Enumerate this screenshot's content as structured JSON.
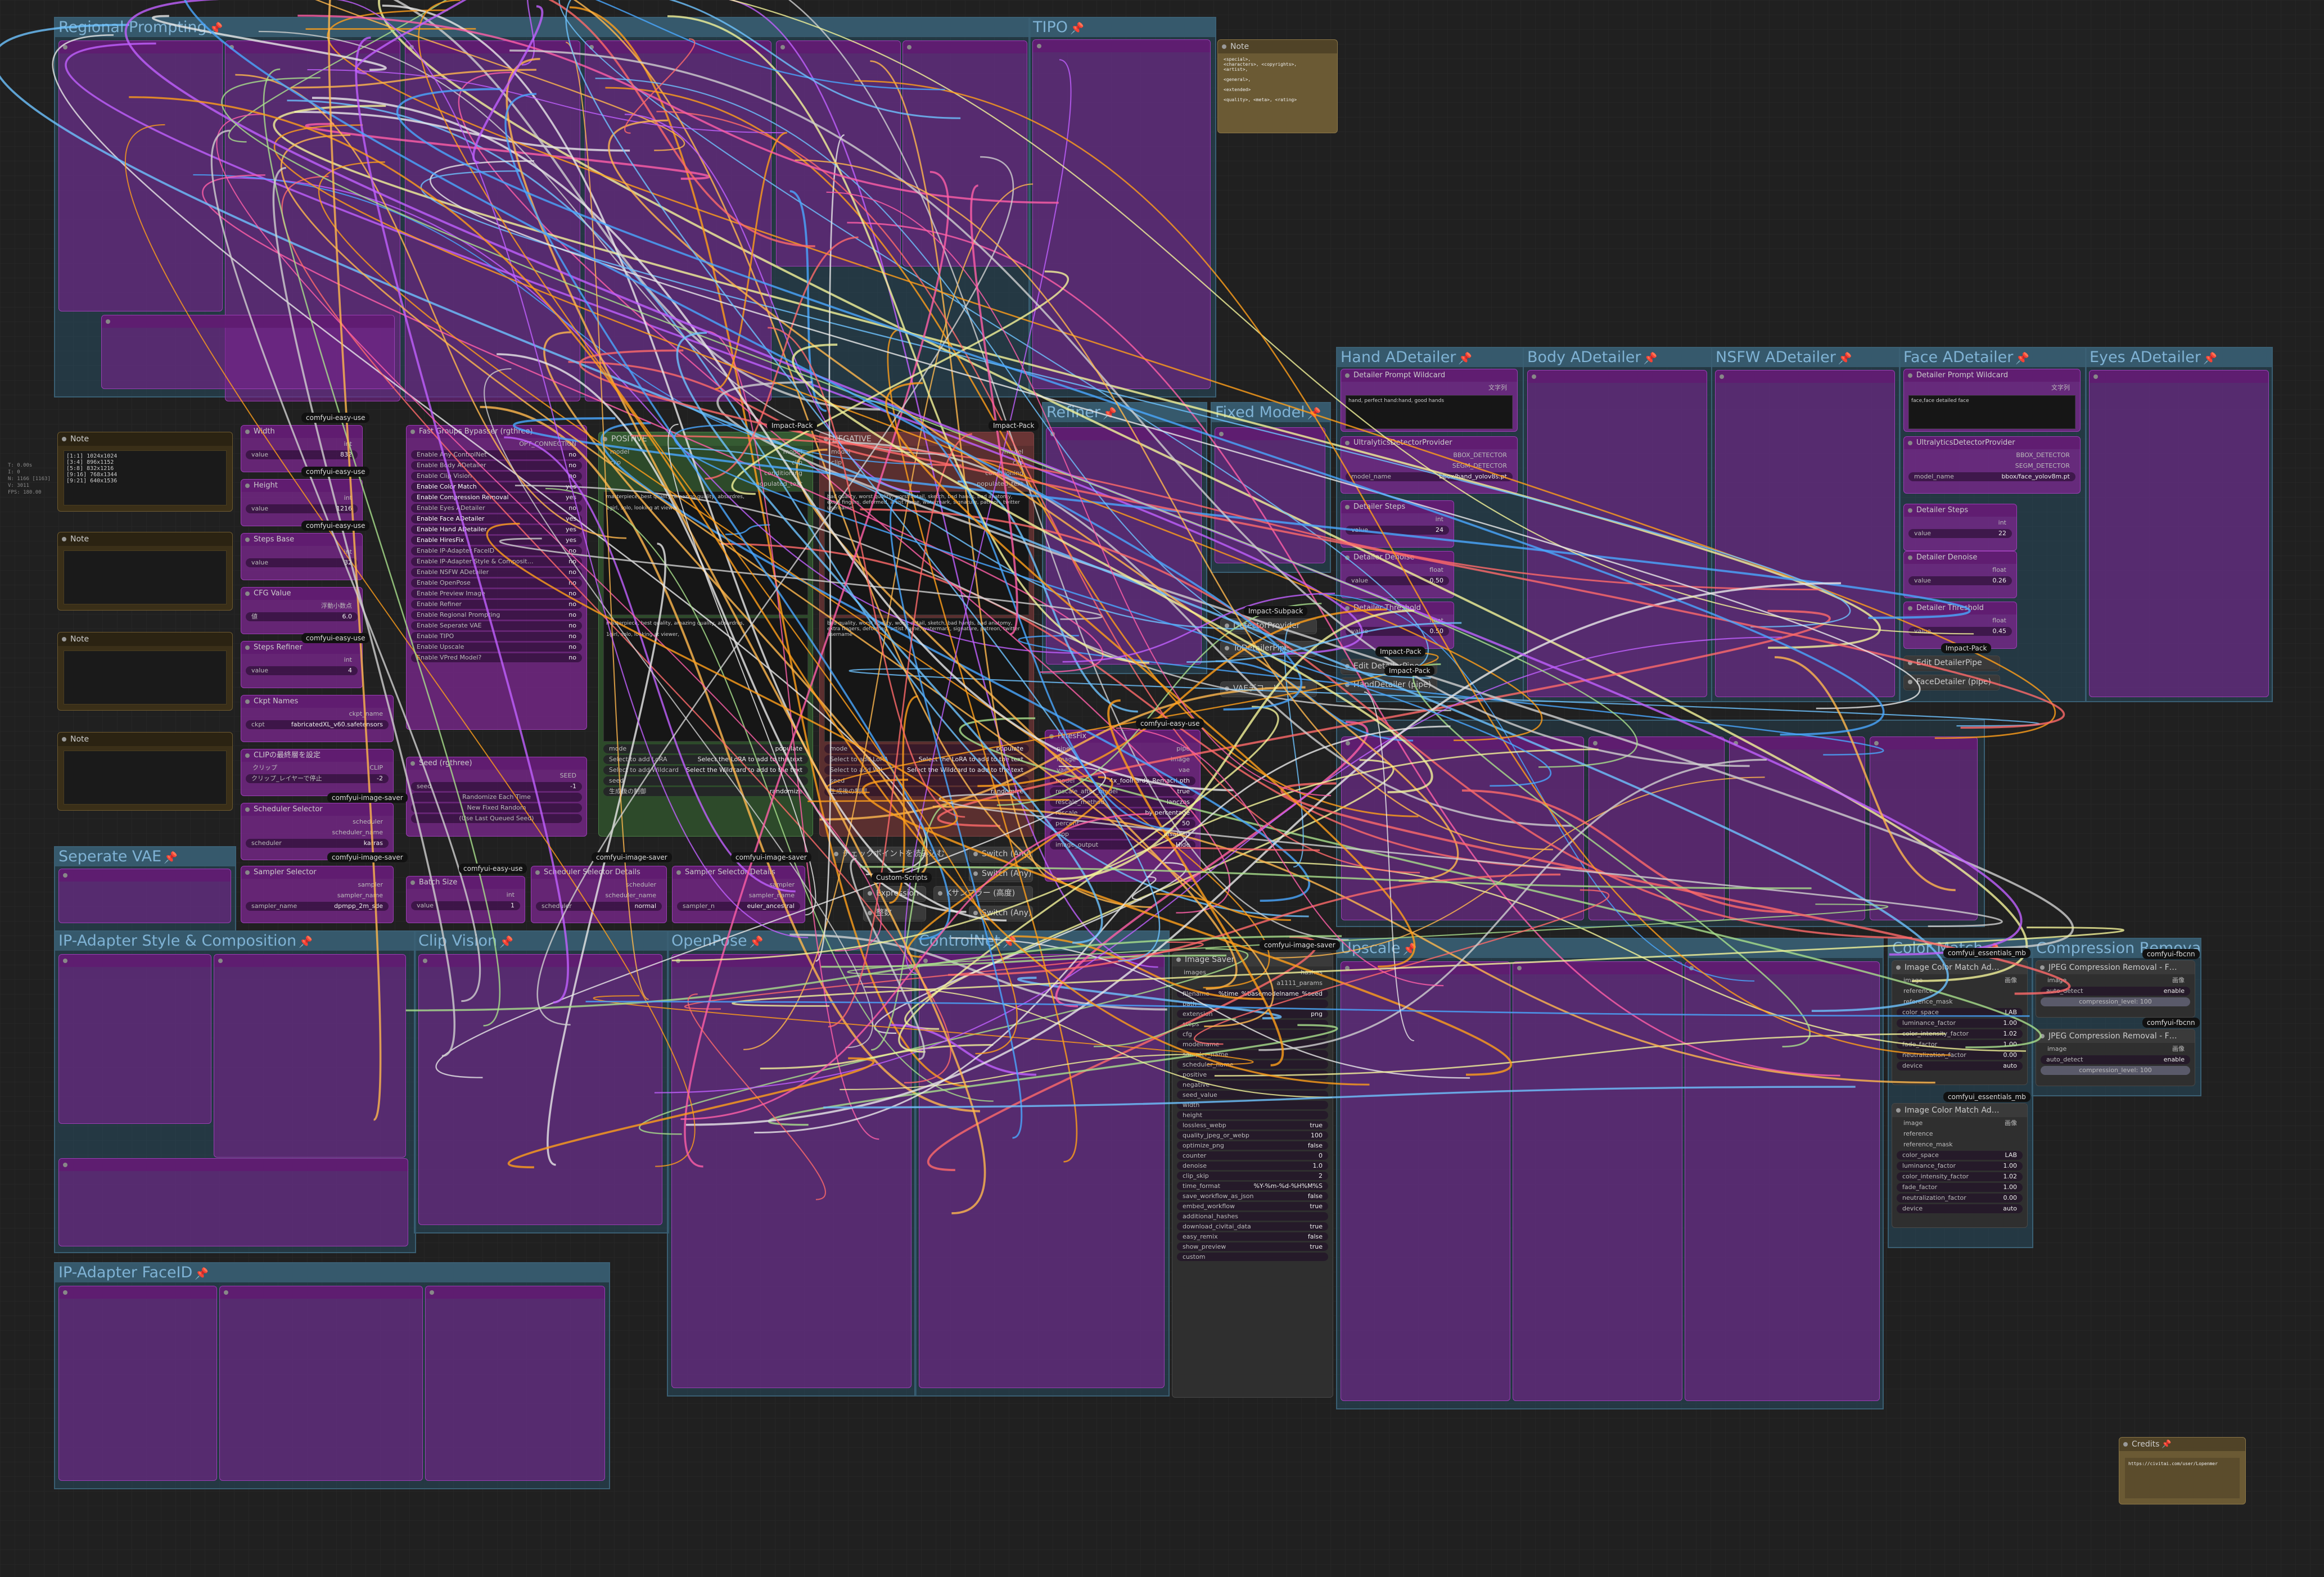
{
  "groups": [
    {
      "id": "regional",
      "title": "Regional Prompting"
    },
    {
      "id": "tipo",
      "title": "TIPO"
    },
    {
      "id": "refiner",
      "title": "Refiner"
    },
    {
      "id": "fixed",
      "title": "Fixed Model"
    },
    {
      "id": "hand",
      "title": "Hand ADetailer"
    },
    {
      "id": "body",
      "title": "Body ADetailer"
    },
    {
      "id": "nsfw",
      "title": "NSFW ADetailer"
    },
    {
      "id": "face",
      "title": "Face ADetailer"
    },
    {
      "id": "eyes",
      "title": "Eyes ADetailer"
    },
    {
      "id": "sepvae",
      "title": "Seperate VAE"
    },
    {
      "id": "ipstyle",
      "title": "IP-Adapter Style & Composition"
    },
    {
      "id": "clipvision",
      "title": "Clip Vision"
    },
    {
      "id": "openpose",
      "title": "OpenPose"
    },
    {
      "id": "controlnet",
      "title": "ControlNet"
    },
    {
      "id": "upscale",
      "title": "Upscale"
    },
    {
      "id": "colormatch",
      "title": "Color Match"
    },
    {
      "id": "compression",
      "title": "Compression Removal"
    },
    {
      "id": "faceid",
      "title": "IP-Adapter FaceID"
    }
  ],
  "badges": {
    "impact1": "Impact-Pack",
    "impact2": "Impact-Pack",
    "impact3": "Impact-Pack",
    "impact4": "Impact-Pack",
    "impact5": "Impact-Pack",
    "impactsub": "Impact-Subpack",
    "easy1": "comfyui-easy-use",
    "easy2": "comfyui-easy-use",
    "easy3": "comfyui-easy-use",
    "easy4": "comfyui-easy-use",
    "easy5": "comfyui-easy-use",
    "easy6": "comfyui-easy-use",
    "saver1": "comfyui-image-saver",
    "saver2": "comfyui-image-saver",
    "saver3": "comfyui-image-saver",
    "saver4": "comfyui-image-saver",
    "saver5": "comfyui-image-saver",
    "custom": "Custom-Scripts",
    "mb1": "comfyui_essentials_mb",
    "mb2": "comfyui_essentials_mb",
    "fbcnn1": "comfyui-fbcnn",
    "fbcnn2": "comfyui-fbcnn"
  },
  "notes": {
    "note1": {
      "title": "Note",
      "text": "[1:1] 1024x1024\n[3:4] 896x1152\n[5:8] 832x1216\n[9:16] 768x1344\n[9:21] 640x1536"
    },
    "note2": {
      "title": "Note"
    },
    "note3": {
      "title": "Note"
    },
    "note4": {
      "title": "Note"
    },
    "note_top": {
      "title": "Note",
      "text": "<special>,\n<characters>, <copyrights>,\n<artist>,\n\n<general>,\n\n<extended>\n\n<quality>, <meta>, <rating>"
    },
    "credits": {
      "title": "Credits",
      "text": "https://civitai.com/user/Lopenmer"
    }
  },
  "width_node": {
    "title": "Width",
    "type": "int",
    "value_label": "value",
    "value": "832"
  },
  "height_node": {
    "title": "Height",
    "type": "int",
    "value_label": "value",
    "value": "1216"
  },
  "steps_base": {
    "title": "Steps Base",
    "type": "int",
    "value_label": "value",
    "value": "32"
  },
  "cfg_value": {
    "title": "CFG Value",
    "type": "浮動小数点",
    "value_label": "値",
    "value": "6.0"
  },
  "steps_refiner": {
    "title": "Steps Refiner",
    "type": "int",
    "value_label": "value",
    "value": "4"
  },
  "ckpt_names": {
    "title": "Ckpt Names",
    "out": "ckpt_name",
    "label": "ckpt",
    "value": "fabricatedXL_v60.safetensors"
  },
  "clip_layer": {
    "title": "CLIPの最終層を設定",
    "in": "クリップ",
    "out": "CLIP",
    "label": "クリップ_レイヤーで停止",
    "value": "-2"
  },
  "scheduler_selector": {
    "title": "Scheduler Selector",
    "out1": "scheduler",
    "out2": "scheduler_name",
    "label": "scheduler",
    "value": "karras"
  },
  "sampler_selector": {
    "title": "Sampler Selector",
    "out1": "sampler",
    "out2": "sampler_name",
    "label": "sampler_name",
    "value": "dpmpp_2m_sde"
  },
  "batch_size": {
    "title": "Batch Size",
    "type": "int",
    "label": "value",
    "value": "1"
  },
  "scheduler_details": {
    "title": "Scheduler Selector Details",
    "out1": "scheduler",
    "out2": "scheduler_name",
    "label": "scheduler",
    "value": "normal"
  },
  "sampler_details": {
    "title": "Sampler Selector Details",
    "out1": "sampler",
    "out2": "sampler_name",
    "label": "sampler_n",
    "value": "euler_ancestral"
  },
  "seed_node": {
    "title": "Seed (rgthree)",
    "out": "SEED",
    "label": "seed",
    "value": "-1",
    "btn1": "Randomize Each Time",
    "btn2": "New Fixed Random",
    "btn3": "(Use Last Queued Seed)"
  },
  "bypasser": {
    "title": "Fast Groups Bypasser (rgthree)",
    "out": "OPT_CONNECTION",
    "items": [
      {
        "label": "Enable Any ControlNet",
        "value": "no"
      },
      {
        "label": "Enable Body ADetailer",
        "value": "no"
      },
      {
        "label": "Enable Clip Vision",
        "value": "no"
      },
      {
        "label": "Enable Color Match",
        "value": "yes"
      },
      {
        "label": "Enable Compression Removal",
        "value": "yes"
      },
      {
        "label": "Enable Eyes ADetailer",
        "value": "no"
      },
      {
        "label": "Enable Face ADetailer",
        "value": "yes"
      },
      {
        "label": "Enable Hand ADetailer",
        "value": "yes"
      },
      {
        "label": "Enable HiresFix",
        "value": "yes"
      },
      {
        "label": "Enable IP-Adapter FaceID",
        "value": "no"
      },
      {
        "label": "Enable IP-Adapter Style & Composit…",
        "value": "no"
      },
      {
        "label": "Enable NSFW ADetailer",
        "value": "no"
      },
      {
        "label": "Enable OpenPose",
        "value": "no"
      },
      {
        "label": "Enable Preview Image",
        "value": "no"
      },
      {
        "label": "Enable Refiner",
        "value": "no"
      },
      {
        "label": "Enable Regional Prompting",
        "value": "no"
      },
      {
        "label": "Enable Seperate VAE",
        "value": "no"
      },
      {
        "label": "Enable TIPO",
        "value": "no"
      },
      {
        "label": "Enable Upscale",
        "value": "no"
      },
      {
        "label": "Enable VPred Model?",
        "value": "no"
      }
    ]
  },
  "positive": {
    "title": "POSITIVE",
    "in1": "model",
    "in2": "clip",
    "out1": "model",
    "out2": "clip",
    "out3": "conditioning",
    "out4": "populated_text",
    "text1": "masterpiece, best quality, amazing quality, absurdres,\n\n1girl, solo, looking at viewer,",
    "text2": "masterpiece, best quality, amazing quality, absurdres,\n\n1girl, solo, looking at viewer,",
    "mode_label": "mode",
    "mode": "populate",
    "lora_label": "Select to add LoRA",
    "lora": "Select the LoRA to add to the text",
    "wc_label": "Select to add Wildcard",
    "wc": "Select the Wildcard to add to the text",
    "seed_label": "seed",
    "ctrl_label": "生成後の制御",
    "ctrl": "randomize"
  },
  "negative": {
    "title": "NEGATIVE",
    "in1": "model",
    "in2": "clip",
    "out1": "model",
    "out2": "clip",
    "out3": "conditioning",
    "out4": "populated_text",
    "text1": "bad quality, worst quality, worst detail, sketch, bad hands, bad anatomy, extra fingers, deformed, artist name, watermark, signature, patreon, twitter username",
    "text2": "bad quality, worst quality, worst detail, sketch, bad hands, bad anatomy, extra fingers, deformed, artist name, watermark, signature, patreon, twitter username",
    "mode_label": "mode",
    "mode": "populate",
    "lora_label": "Select to add LoRA",
    "lora": "Select the LoRA to add to the text",
    "wc_label": "Select to add Wil",
    "wc": "Select the Wildcard to add to the text",
    "seed_label": "seed",
    "ctrl_label": "生成後の制御",
    "ctrl": "randomize"
  },
  "mid_nodes": {
    "ckpt_loader": "チェックポイントを読み込む",
    "switch1": "Switch (Any)",
    "switch2": "Switch (Any)",
    "switch3": "Switch (Any)",
    "expression": "Expression",
    "ksampler": "Kサンプラー (高度)",
    "integer": "整数"
  },
  "hiresfix": {
    "title": "HiresFix",
    "in1": "pipe",
    "in2": "image",
    "in3": "vae",
    "out1": "pipe",
    "out2": "image",
    "out3": "vae",
    "rows": [
      {
        "label": "model",
        "value": "4x_foolhardy_Remacri.pth"
      },
      {
        "label": "rescale_after_model",
        "value": "true"
      },
      {
        "label": "rescale_method",
        "value": "lanczos"
      },
      {
        "label": "rescale",
        "value": "by percentage"
      },
      {
        "label": "percent",
        "value": "50"
      },
      {
        "label": "crop",
        "value": "disabled"
      },
      {
        "label": "image_output",
        "value": "Hide"
      }
    ]
  },
  "detector": {
    "n1": "DetectorProvider",
    "n2": "ToDetailerPipe",
    "n3": "VAEデコード"
  },
  "hand": {
    "wildcard": {
      "title": "Detailer Prompt Wildcard",
      "type": "文字列",
      "text": "hand, perfect hand:hand, good hands"
    },
    "ultra": {
      "title": "UltralyticsDetectorProvider",
      "out1": "BBOX_DETECTOR",
      "out2": "SEGM_DETECTOR",
      "label": "model_name",
      "value": "bbox/hand_yolov8s.pt"
    },
    "steps": {
      "title": "Detailer Steps",
      "type": "int",
      "label": "value",
      "value": "24"
    },
    "denoise": {
      "title": "Detailer Denoise",
      "type": "float",
      "label": "value",
      "value": "0.50"
    },
    "threshold": {
      "title": "Detailer Threshold",
      "type": "float",
      "label": "value",
      "value": "0.50"
    },
    "editpipe": "Edit DetailerPipe",
    "detailer": "HandDetailer (pipe)"
  },
  "face": {
    "wildcard": {
      "title": "Detailer Prompt Wildcard",
      "type": "文字列",
      "text": "face,face detailed face"
    },
    "ultra": {
      "title": "UltralyticsDetectorProvider",
      "out1": "BBOX_DETECTOR",
      "out2": "SEGM_DETECTOR",
      "label": "model_name",
      "value": "bbox/face_yolov8m.pt"
    },
    "steps": {
      "title": "Detailer Steps",
      "type": "int",
      "label": "value",
      "value": "22"
    },
    "denoise": {
      "title": "Detailer Denoise",
      "type": "float",
      "label": "value",
      "value": "0.26"
    },
    "threshold": {
      "title": "Detailer Threshold",
      "type": "float",
      "label": "value",
      "value": "0.45"
    },
    "editpipe": "Edit DetailerPipe",
    "detailer": "FaceDetailer (pipe)"
  },
  "image_saver": {
    "title": "Image Saver",
    "in": "images",
    "out1": "hashes",
    "out2": "a1111_params",
    "rows": [
      {
        "label": "filename",
        "value": "%time_%basemodelname_%seed"
      },
      {
        "label": "path",
        "value": ""
      },
      {
        "label": "extension",
        "value": "png"
      },
      {
        "label": "steps",
        "value": ""
      },
      {
        "label": "cfg",
        "value": ""
      },
      {
        "label": "modelname",
        "value": ""
      },
      {
        "label": "sampler_name",
        "value": ""
      },
      {
        "label": "scheduler_name",
        "value": ""
      },
      {
        "label": "positive",
        "value": ""
      },
      {
        "label": "negative",
        "value": ""
      },
      {
        "label": "seed_value",
        "value": ""
      },
      {
        "label": "width",
        "value": ""
      },
      {
        "label": "height",
        "value": ""
      },
      {
        "label": "lossless_webp",
        "value": "true"
      },
      {
        "label": "quality_jpeg_or_webp",
        "value": "100"
      },
      {
        "label": "optimize_png",
        "value": "false"
      },
      {
        "label": "counter",
        "value": "0"
      },
      {
        "label": "denoise",
        "value": "1.0"
      },
      {
        "label": "clip_skip",
        "value": "2"
      },
      {
        "label": "time_format",
        "value": "%Y-%m-%d-%H%M%S"
      },
      {
        "label": "save_workflow_as_json",
        "value": "false"
      },
      {
        "label": "embed_workflow",
        "value": "true"
      },
      {
        "label": "additional_hashes",
        "value": ""
      },
      {
        "label": "download_civitai_data",
        "value": "true"
      },
      {
        "label": "easy_remix",
        "value": "false"
      },
      {
        "label": "show_preview",
        "value": "true"
      },
      {
        "label": "custom",
        "value": ""
      }
    ]
  },
  "color_match": [
    {
      "title": "Image Color Match Ad…",
      "in1": "image",
      "in2": "reference",
      "in3": "reference_mask",
      "out": "画像",
      "rows": [
        {
          "label": "color_space",
          "value": "LAB"
        },
        {
          "label": "luminance_factor",
          "value": "1.00"
        },
        {
          "label": "color_intensity_factor",
          "value": "1.02"
        },
        {
          "label": "fade_factor",
          "value": "1.00"
        },
        {
          "label": "neutralization_factor",
          "value": "0.00"
        },
        {
          "label": "device",
          "value": "auto"
        }
      ]
    },
    {
      "title": "Image Color Match Ad…",
      "in1": "image",
      "in2": "reference",
      "in3": "reference_mask",
      "out": "画像",
      "rows": [
        {
          "label": "color_space",
          "value": "LAB"
        },
        {
          "label": "luminance_factor",
          "value": "1.00"
        },
        {
          "label": "color_intensity_factor",
          "value": "1.02"
        },
        {
          "label": "fade_factor",
          "value": "1.00"
        },
        {
          "label": "neutralization_factor",
          "value": "0.00"
        },
        {
          "label": "device",
          "value": "auto"
        }
      ]
    }
  ],
  "jpeg_removal": [
    {
      "title": "JPEG Compression Removal - F…",
      "in": "image",
      "out": "画像",
      "label": "auto_detect",
      "value": "enable",
      "level": "compression_level: 100"
    },
    {
      "title": "JPEG Compression Removal - F…",
      "in": "image",
      "out": "画像",
      "label": "auto_detect",
      "value": "enable",
      "level": "compression_level: 100"
    }
  ],
  "side_info": "T: 0.00s\nI: 0\nN: 1166 [1163]\nV: 3011\nFPS: 180.00"
}
